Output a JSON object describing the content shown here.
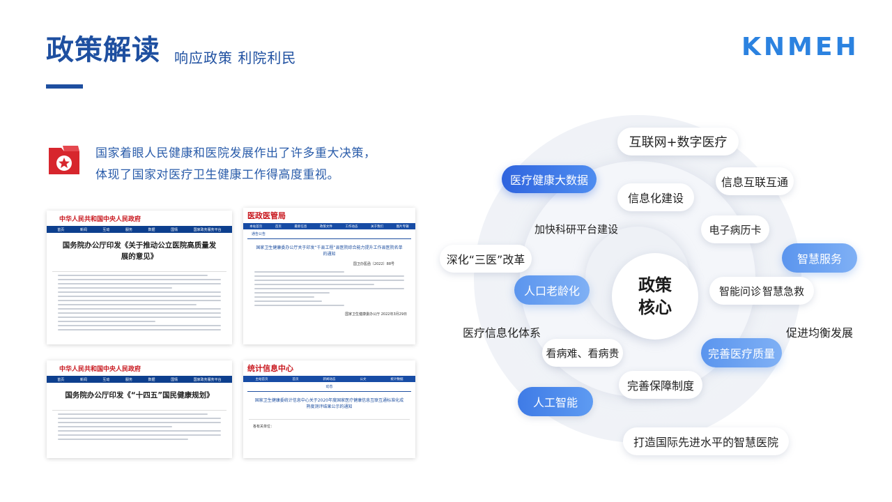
{
  "header": {
    "title": "政策解读",
    "subtitle": "响应政策  利院利民",
    "logo_text": "KNMEH"
  },
  "intro": {
    "line1": "国家着眼人民健康和医院发展作出了许多重大决策，",
    "line2": "体现了国家对医疗卫生健康工作得高度重视。"
  },
  "documents": {
    "doc1": {
      "site": "中华人民共和国中央人民政府",
      "nav": [
        "首页",
        "新闻",
        "互动",
        "服务",
        "数据",
        "国情",
        "国家政务服务平台"
      ],
      "title": "国务院办公厅印发《关于推动公立医院高质量发展的意见》"
    },
    "doc2": {
      "site": "医政医管局",
      "nav": [
        "本站首页",
        "首页",
        "最新信息",
        "政策文件",
        "工作动态",
        "关于我们",
        "图片专辑"
      ],
      "section": "通告公告",
      "title": "国家卫生健康委办公厅关于印发“千县工程”县医院综合能力提升工作县医院名单的通知",
      "ref": "国卫办医函〔2022〕88号",
      "date": "国家卫生健康委办公厅 2022年3月29日"
    },
    "doc3": {
      "site": "中华人民共和国中央人民政府",
      "nav": [
        "首页",
        "新闻",
        "互动",
        "服务",
        "数据",
        "国情",
        "国家政务服务平台"
      ],
      "title": "国务院办公厅印发《“十四五”国民健康规划》"
    },
    "doc4": {
      "site": "统计信息中心",
      "nav": [
        "主站首页",
        "首页",
        "新闻动态",
        "公文",
        "统计数据"
      ],
      "section": "动态",
      "title": "国家卫生健康委统计信息中心关于2020年度国家医疗健康信息互联互通标准化成熟度测评结果公示的通知",
      "greeting": "各有关单位："
    }
  },
  "diagram": {
    "core_line1": "政策",
    "core_line2": "核心",
    "items": {
      "internet": "互联网+数字医疗",
      "bigdata": "医疗健康大数据",
      "info_exchange": "信息互联互通",
      "info_build": "信息化建设",
      "research": "加快科研平台建设",
      "emr": "电子病历卡",
      "reform": "深化“三医”改革",
      "smart_service": "智慧服务",
      "aging": "人口老龄化",
      "smart_consult": "智能问诊",
      "smart_rescue": "智慧急救",
      "med_info_system": "医疗信息化体系",
      "balance": "促进均衡发展",
      "hard_costly": "看病难、看病贵",
      "quality": "完善医疗质量",
      "security": "完善保障制度",
      "ai": "人工智能",
      "smart_hospital": "打造国际先进水平的智慧医院"
    }
  },
  "colors": {
    "primary": "#1e4fa0",
    "accent": "#2f64de",
    "logo": "#2b82e0",
    "red": "#c8161d"
  }
}
